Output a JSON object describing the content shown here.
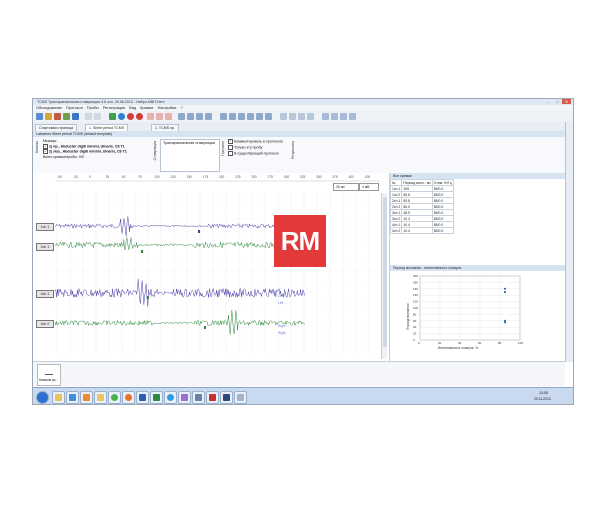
{
  "window": {
    "title": "TCMS Транскраниальная стимуляция 4.8 осн. 20.06.2013 - Нейро-МВП-Нетт",
    "minimize": "–",
    "maximize": "□",
    "close": "✕"
  },
  "menu": [
    "Обследование",
    "Протокол",
    "Пробы",
    "Регистрация",
    "Вид",
    "Кривые",
    "Настройка",
    "?"
  ],
  "tabs": [
    {
      "label": "Стартовая страница",
      "active": false
    },
    {
      "label": "1. Silent period TCMS",
      "active": true
    },
    {
      "label": "1. TCMS пр.",
      "active": false
    }
  ],
  "document_header": "Labarees Silent period TCMS (default template)",
  "controls": {
    "section_channels_label": "Каналы",
    "muscles_title": "Мышцы:",
    "muscles": [
      {
        "label": "1) пр., Abductor digiti minimi, Ulnaris, C8 T1",
        "checked": true
      },
      {
        "label": "2) лев., Abductor digiti minimi, Ulnaris, C8 T1",
        "checked": true
      }
    ],
    "total_label": "Всего кривых/пробы: 0/0",
    "section_stim_label": "Стимуляция",
    "stim_field_label": "Транскраниальная стимуляция",
    "section_protocol_label": "Протокол",
    "options": [
      {
        "label": "Комментировать в протоколе",
        "checked": true
      },
      {
        "label": "Только эту пробу",
        "checked": false
      },
      {
        "label": "В существующий протокол",
        "checked": false
      }
    ],
    "section_results_label": "Результаты"
  },
  "plot": {
    "axis_ticks": [
      "-50",
      "-25",
      "0",
      "25",
      "50",
      "75",
      "100",
      "125",
      "150",
      "175",
      "200",
      "225",
      "250",
      "275",
      "300",
      "325",
      "350",
      "375",
      "400",
      "425"
    ],
    "scale_time": "25 мс",
    "scale_amp": "4 мВ",
    "channels": [
      {
        "label": "1ch 1",
        "color": "#4a3ea8"
      },
      {
        "label": "2ch 1",
        "color": "#2f8a3f"
      },
      {
        "label": "4ch 1",
        "color": "#4a3ea8"
      },
      {
        "label": "4ch 2",
        "color": "#2f8a3f"
      }
    ],
    "annotations": [
      "Left",
      "Right",
      "Left ...",
      "Right ..."
    ]
  },
  "results_table": {
    "title": "Все кривые",
    "headers": [
      "№",
      "Период молч., мс",
      "Стим. %/Гц"
    ],
    "rows": [
      [
        "1ch 1",
        "159",
        "85/0.0"
      ],
      [
        "1ch 2",
        "55.6",
        "85/0.0"
      ],
      [
        "2ch 1",
        "55.8",
        "85/0.0"
      ],
      [
        "2ch 2",
        "56.0",
        "85/0.0"
      ],
      [
        "3ch 1",
        "48.5",
        "85/0.0"
      ],
      [
        "3ch 2",
        "10.4",
        "85/0.0"
      ],
      [
        "4ch 1",
        "10.4",
        "85/0.0"
      ],
      [
        "4ch 2",
        "10.4",
        "85/0.0"
      ]
    ]
  },
  "chart_data": {
    "type": "scatter",
    "title": "Период молчания - интенсивность стимула",
    "xlabel": "Интенсивность стимула, %",
    "ylabel": "Период молчания",
    "xlim": [
      0,
      100
    ],
    "ylim": [
      0,
      200
    ],
    "x_ticks": [
      "0",
      "20",
      "40",
      "60",
      "80",
      "100"
    ],
    "y_ticks": [
      "0",
      "20",
      "40",
      "60",
      "80",
      "100",
      "120",
      "140",
      "160",
      "180",
      "200"
    ],
    "series": [
      {
        "color": "#2a4fbf",
        "x": [
          85,
          85,
          85,
          85
        ],
        "y": [
          150,
          160,
          55,
          60
        ]
      }
    ]
  },
  "bottom": {
    "item_label": "Кальков пр..."
  },
  "taskbar": {
    "time": "13:05",
    "date": "20.11.2013",
    "apps": [
      "explorer",
      "ie",
      "media",
      "folder",
      "chrome",
      "firefox",
      "word",
      "excel",
      "skype",
      "paint",
      "neuro",
      "acrobat",
      "photoshop",
      "tcms"
    ]
  },
  "watermark": "RM"
}
